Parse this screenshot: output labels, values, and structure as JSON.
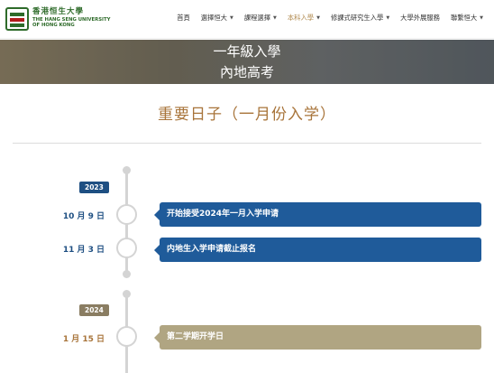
{
  "logo": {
    "zh": "香港恒生大學",
    "en_line1": "THE HANG SENG UNIVERSITY",
    "en_line2": "OF HONG KONG"
  },
  "nav": [
    {
      "label": "首頁",
      "dropdown": false
    },
    {
      "label": "選擇恒大",
      "dropdown": true
    },
    {
      "label": "課程選擇",
      "dropdown": true
    },
    {
      "label": "本科入學",
      "dropdown": true
    },
    {
      "label": "修課式研究生入學",
      "dropdown": true
    },
    {
      "label": "大學外展服務",
      "dropdown": false
    },
    {
      "label": "聯繫恒大",
      "dropdown": true
    }
  ],
  "banner": {
    "line1": "一年級入學",
    "line2": "內地高考"
  },
  "heading": "重要日子（一月份入学）",
  "timeline": {
    "groups": [
      {
        "year": "2023",
        "events": [
          {
            "date": "10 月 9 日",
            "text": "开始接受2024年一月入学申请"
          },
          {
            "date": "11 月 3 日",
            "text": "内地生入学申请截止报名"
          }
        ]
      },
      {
        "year": "2024",
        "events": [
          {
            "date": "1 月 15 日",
            "text": "第二学期开学日"
          }
        ]
      }
    ]
  },
  "colors": {
    "brand_green": "#2e6b2a",
    "accent_gold": "#a8743a",
    "event_blue": "#1f5b9a",
    "event_gold": "#b0a582"
  }
}
